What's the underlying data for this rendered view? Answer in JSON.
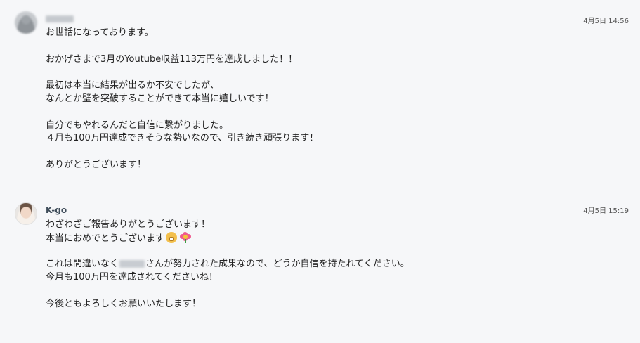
{
  "messages": [
    {
      "sender": "",
      "time": "4月5日 14:56",
      "lines": [
        "お世話になっております。",
        "",
        "おかげさまで3月のYoutube収益113万円を達成しました！！",
        "",
        "最初は本当に結果が出るか不安でしたが、",
        "なんとか壁を突破することができて本当に嬉しいです！",
        "",
        "自分でもやれるんだと自信に繋がりました。",
        "４月も100万円達成できそうな勢いなので、引き続き頑張ります！",
        "",
        "ありがとうございます！"
      ]
    },
    {
      "sender": "K-go",
      "time": "4月5日 15:19",
      "line1": "わざわざご報告ありがとうございます！",
      "line2": "本当におめでとうございます",
      "line2_icons": [
        "grinning-face-emoji-icon",
        "flower-emoji-icon"
      ],
      "line4_pre": "これは間違いなく",
      "line4_post": "さんが努力された成果なので、どうか自信を持たれてください。",
      "line5": "今月も100万円を達成されてくださいね！",
      "line7": "今後ともよろしくお願いいたします！"
    }
  ]
}
